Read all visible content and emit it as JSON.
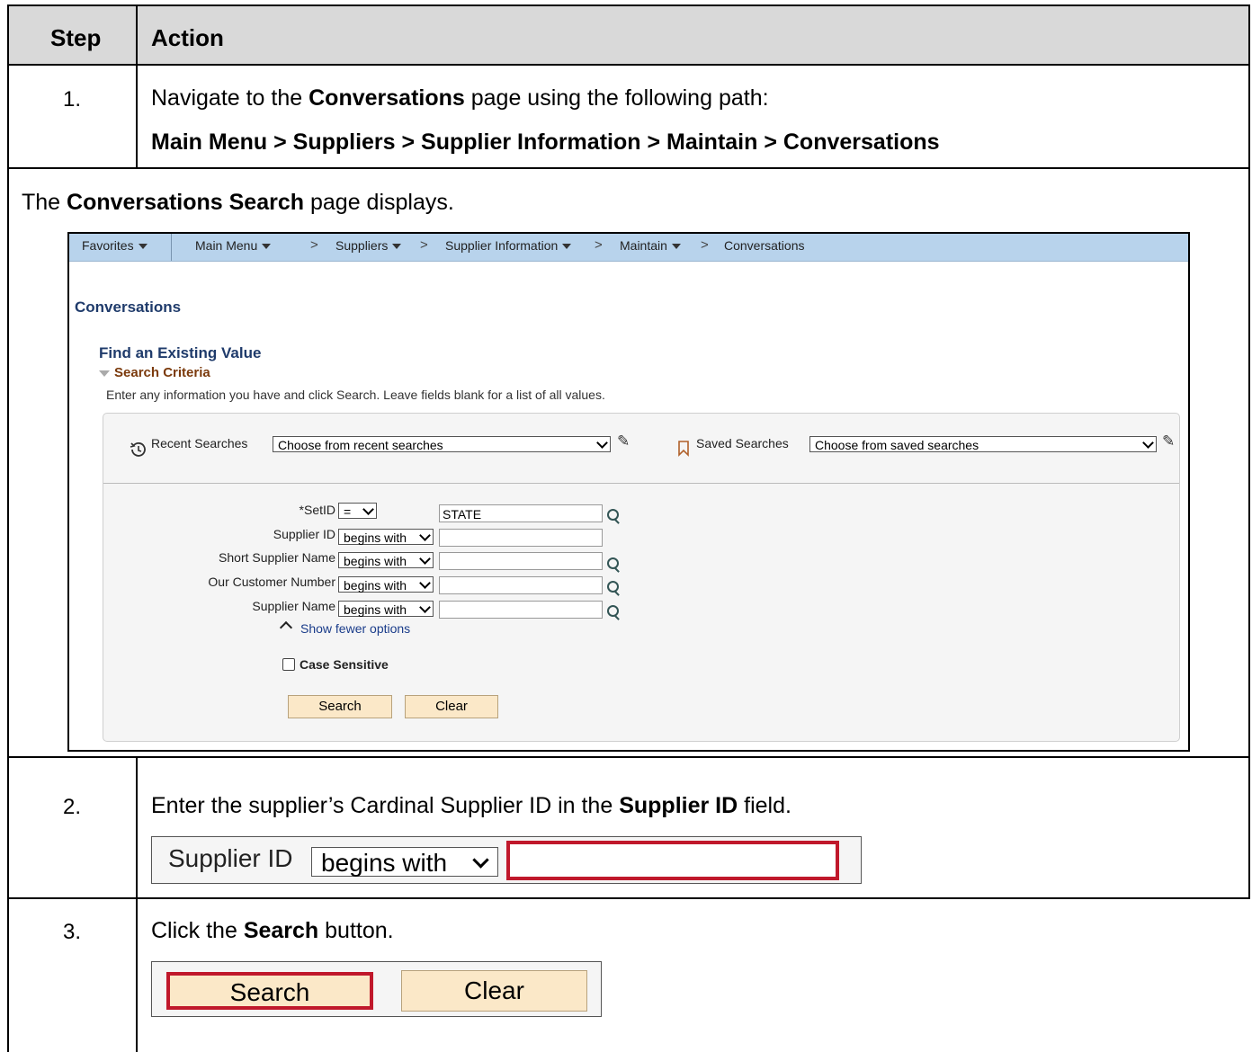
{
  "table": {
    "headers": {
      "step": "Step",
      "action": "Action"
    },
    "steps": [
      {
        "num": "1.",
        "text_pre": "Navigate to the ",
        "text_bold": "Conversations",
        "text_post": " page using the following path:",
        "path": "Main Menu > Suppliers > Supplier Information > Maintain > Conversations"
      },
      {
        "num": "2.",
        "text_pre": "Enter the supplier’s Cardinal Supplier ID in the ",
        "text_bold": "Supplier ID",
        "text_post": " field."
      },
      {
        "num": "3.",
        "text_pre": "Click the ",
        "text_bold": "Search",
        "text_post": " button."
      }
    ],
    "note": {
      "pre": "The ",
      "bold": "Conversations Search",
      "post": " page displays."
    }
  },
  "screenshot": {
    "nav": {
      "favorites": "Favorites",
      "main_menu": "Main Menu",
      "suppliers": "Suppliers",
      "supplier_information": "Supplier Information",
      "maintain": "Maintain",
      "conversations": "Conversations",
      "sep": ">"
    },
    "page_title": "Conversations",
    "find_title": "Find an Existing Value",
    "criteria": "Search Criteria",
    "instructions": "Enter any information you have and click Search. Leave fields blank for a list of all values.",
    "recent_label": "Recent Searches",
    "recent_placeholder": "Choose from recent searches",
    "saved_label": "Saved Searches",
    "saved_placeholder": "Choose from saved searches",
    "fields": [
      {
        "label": "*SetID",
        "op": "=",
        "value": "STATE"
      },
      {
        "label": "Supplier ID",
        "op": "begins with",
        "value": ""
      },
      {
        "label": "Short Supplier Name",
        "op": "begins with",
        "value": ""
      },
      {
        "label": "Our Customer Number",
        "op": "begins with",
        "value": ""
      },
      {
        "label": "Supplier Name",
        "op": "begins with",
        "value": ""
      }
    ],
    "show_fewer": "Show fewer options",
    "case_sensitive": "Case Sensitive",
    "search_btn": "Search",
    "clear_btn": "Clear"
  },
  "snippet2": {
    "label": "Supplier ID",
    "op": "begins with"
  },
  "snippet3": {
    "search": "Search",
    "clear": "Clear"
  }
}
